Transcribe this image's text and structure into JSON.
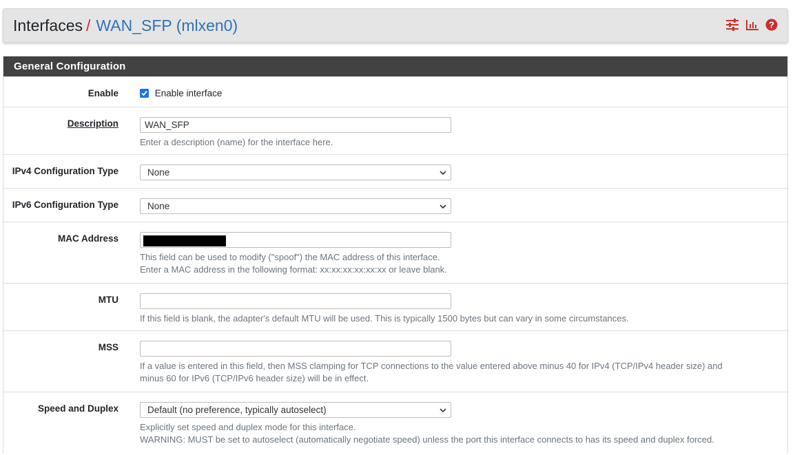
{
  "breadcrumb": {
    "root": "Interfaces",
    "separator": "/",
    "current": "WAN_SFP (mlxen0)"
  },
  "header_icons": [
    "sliders-icon",
    "bar-chart-icon",
    "help-icon"
  ],
  "colors": {
    "accent_red": "#c9302c",
    "link_blue": "#2f72b5",
    "panel_heading_bg": "#424242",
    "checkbox_blue": "#1a73e8"
  },
  "panel": {
    "title": "General Configuration"
  },
  "fields": {
    "enable": {
      "label": "Enable",
      "checkbox_label": "Enable interface",
      "checked": true
    },
    "description": {
      "label": "Description",
      "value": "WAN_SFP",
      "help": "Enter a description (name) for the interface here."
    },
    "ipv4_type": {
      "label": "IPv4 Configuration Type",
      "selected": "None"
    },
    "ipv6_type": {
      "label": "IPv6 Configuration Type",
      "selected": "None"
    },
    "mac": {
      "label": "MAC Address",
      "value": "",
      "help1": "This field can be used to modify (\"spoof\") the MAC address of this interface.",
      "help2": "Enter a MAC address in the following format: xx:xx:xx:xx:xx:xx or leave blank."
    },
    "mtu": {
      "label": "MTU",
      "value": "",
      "help": "If this field is blank, the adapter's default MTU will be used. This is typically 1500 bytes but can vary in some circumstances."
    },
    "mss": {
      "label": "MSS",
      "value": "",
      "help1": "If a value is entered in this field, then MSS clamping for TCP connections to the value entered above minus 40 for IPv4 (TCP/IPv4 header size) and",
      "help2": "minus 60 for IPv6 (TCP/IPv6 header size) will be in effect."
    },
    "speed": {
      "label": "Speed and Duplex",
      "selected": "Default (no preference, typically autoselect)",
      "help1": "Explicitly set speed and duplex mode for this interface.",
      "help2": "WARNING: MUST be set to autoselect (automatically negotiate speed) unless the port this interface connects to has its speed and duplex forced."
    }
  }
}
